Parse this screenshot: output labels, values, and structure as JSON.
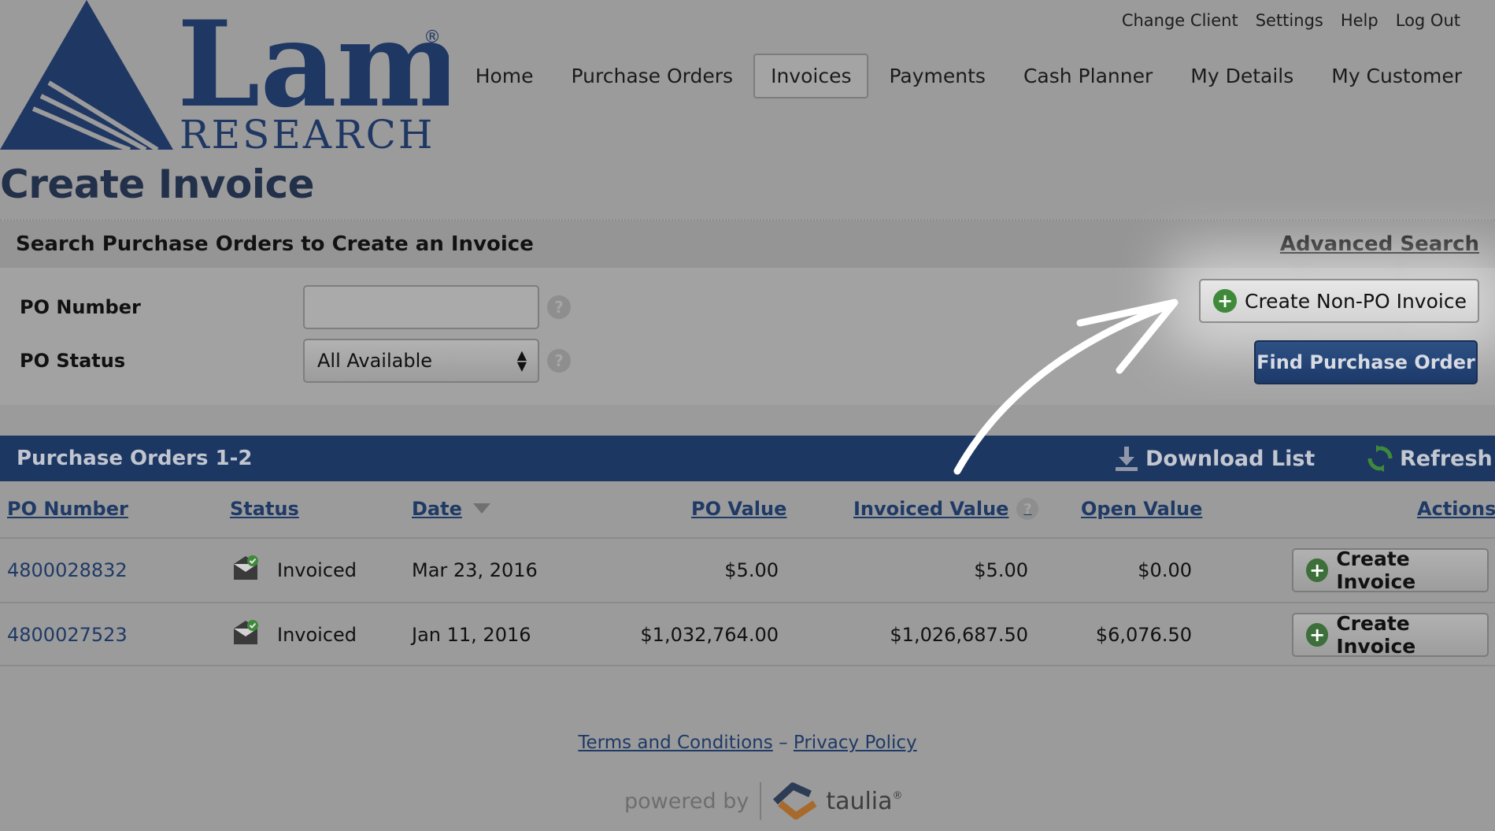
{
  "header": {
    "logo_text_main": "Lam",
    "logo_text_sub": "RESEARCH",
    "logo_registered": "®",
    "utility_nav": [
      "Change Client",
      "Settings",
      "Help",
      "Log Out"
    ],
    "main_nav": [
      {
        "label": "Home",
        "active": false
      },
      {
        "label": "Purchase Orders",
        "active": false
      },
      {
        "label": "Invoices",
        "active": true
      },
      {
        "label": "Payments",
        "active": false
      },
      {
        "label": "Cash Planner",
        "active": false
      },
      {
        "label": "My Details",
        "active": false
      },
      {
        "label": "My Customer",
        "active": false
      }
    ]
  },
  "page_title": "Create Invoice",
  "search": {
    "title": "Search Purchase Orders to Create an Invoice",
    "advanced_link": "Advanced Search",
    "po_number_label": "PO Number",
    "po_number_value": "",
    "po_status_label": "PO Status",
    "po_status_value": "All Available",
    "help_glyph": "?",
    "create_non_po_label": "Create Non-PO Invoice",
    "find_label": "Find Purchase Order"
  },
  "list": {
    "title": "Purchase Orders 1-2",
    "download_label": "Download List",
    "refresh_label": "Refresh",
    "columns": {
      "po_number": "PO Number",
      "status": "Status",
      "date": "Date",
      "po_value": "PO Value",
      "invoiced_value": "Invoiced Value",
      "open_value": "Open Value",
      "actions": "Actions"
    },
    "rows": [
      {
        "po_number": "4800028832",
        "status": "Invoiced",
        "date": "Mar 23, 2016",
        "po_value": "$5.00",
        "invoiced_value": "$5.00",
        "open_value": "$0.00",
        "action": "Create Invoice"
      },
      {
        "po_number": "4800027523",
        "status": "Invoiced",
        "date": "Jan 11, 2016",
        "po_value": "$1,032,764.00",
        "invoiced_value": "$1,026,687.50",
        "open_value": "$6,076.50",
        "action": "Create Invoice"
      }
    ]
  },
  "footer": {
    "terms": "Terms and Conditions",
    "separator": "–",
    "privacy": "Privacy Policy",
    "powered_by": "powered by",
    "brand": "taulia",
    "brand_mark": "®"
  },
  "colors": {
    "navy": "#1d3763",
    "link": "#1f3a66",
    "plus_green": "#3e8a3a"
  }
}
